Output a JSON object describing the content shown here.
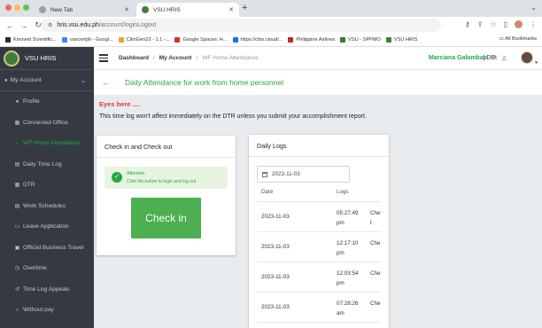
{
  "browser": {
    "tabs": [
      {
        "label": "New Tab",
        "active": false
      },
      {
        "label": "VSU HRIS",
        "active": true
      }
    ],
    "url_host": "hris.vsu.edu.ph",
    "url_path": "/account/loginLogout",
    "bookmarks": [
      {
        "label": "Kinovett Scientific...",
        "color": "#2b2b2b"
      },
      {
        "label": "vaxcertph - Googl...",
        "color": "#4285f4"
      },
      {
        "label": "ClimGen22 - 1.1 -...",
        "color": "#e8a33a"
      },
      {
        "label": "Google Spaces: H...",
        "color": "#d93025"
      },
      {
        "label": "https://cfss.cloud/...",
        "color": "#1a73e8"
      },
      {
        "label": "Philippine Airlines",
        "color": "#c62828"
      },
      {
        "label": "VSU - SPPMO",
        "color": "#2e7d32"
      },
      {
        "label": "VSU HRIS",
        "color": "#3f7e3a"
      }
    ],
    "all_bookmarks": "All Bookmarks"
  },
  "sidebar": {
    "brand": "VSU HRIS",
    "section": "My Account",
    "items": [
      {
        "label": "Profile",
        "icon": "person-icon",
        "glyph": "●",
        "active": false
      },
      {
        "label": "Connected Office",
        "icon": "building-icon",
        "glyph": "▦",
        "active": false
      },
      {
        "label": "WF Home Attendance",
        "icon": "home-icon",
        "glyph": "⌂",
        "active": true
      },
      {
        "label": "Daily Time Log",
        "icon": "calendar-icon",
        "glyph": "▤",
        "active": false
      },
      {
        "label": "DTR",
        "icon": "table-icon",
        "glyph": "▦",
        "active": false
      },
      {
        "label": "Work Schedules",
        "icon": "calendar-icon",
        "glyph": "▤",
        "active": false
      },
      {
        "label": "Leave Application",
        "icon": "document-icon",
        "glyph": "▭",
        "active": false
      },
      {
        "label": "Official Business Travel",
        "icon": "briefcase-icon",
        "glyph": "▣",
        "active": false
      },
      {
        "label": "Overtime",
        "icon": "clock-icon",
        "glyph": "◷",
        "active": false
      },
      {
        "label": "Time Log Appeals",
        "icon": "history-icon",
        "glyph": "↺",
        "active": false
      },
      {
        "label": "Without pay",
        "icon": "money-icon",
        "glyph": "○",
        "active": false
      }
    ]
  },
  "topnav": {
    "crumb_dashboard": "Dashboard",
    "crumb_account": "My Account",
    "crumb_current": "WF Home Attendance",
    "user_name": "Marciana Galambao",
    "user_suffix": "| DBt"
  },
  "content": {
    "title": "Daily Attendance for work from home personnel",
    "warning_title": "Eyes here ....",
    "warning_text": "This time log won't affect immediately on the DTR unless you submit your accomplishment report."
  },
  "checkin_card": {
    "title": "Check in and Check out",
    "attention_title": "Attention",
    "attention_text": "Click the button to login and log out",
    "button_label": "Check in"
  },
  "logs_card": {
    "title": "Daily Logs",
    "date_value": "2023-11-03",
    "col_date": "Date",
    "col_logs": "Logs",
    "rows": [
      {
        "date": "2023-11-03",
        "time": "05:27:49 pm",
        "trunc": "Che t"
      },
      {
        "date": "2023-11-03",
        "time": "12:17:10 pm",
        "trunc": "Che"
      },
      {
        "date": "2023-11-03",
        "time": "12:03:54 pm",
        "trunc": "Che"
      },
      {
        "date": "2023-11-03",
        "time": "07:28:26 am",
        "trunc": "Che"
      }
    ]
  }
}
